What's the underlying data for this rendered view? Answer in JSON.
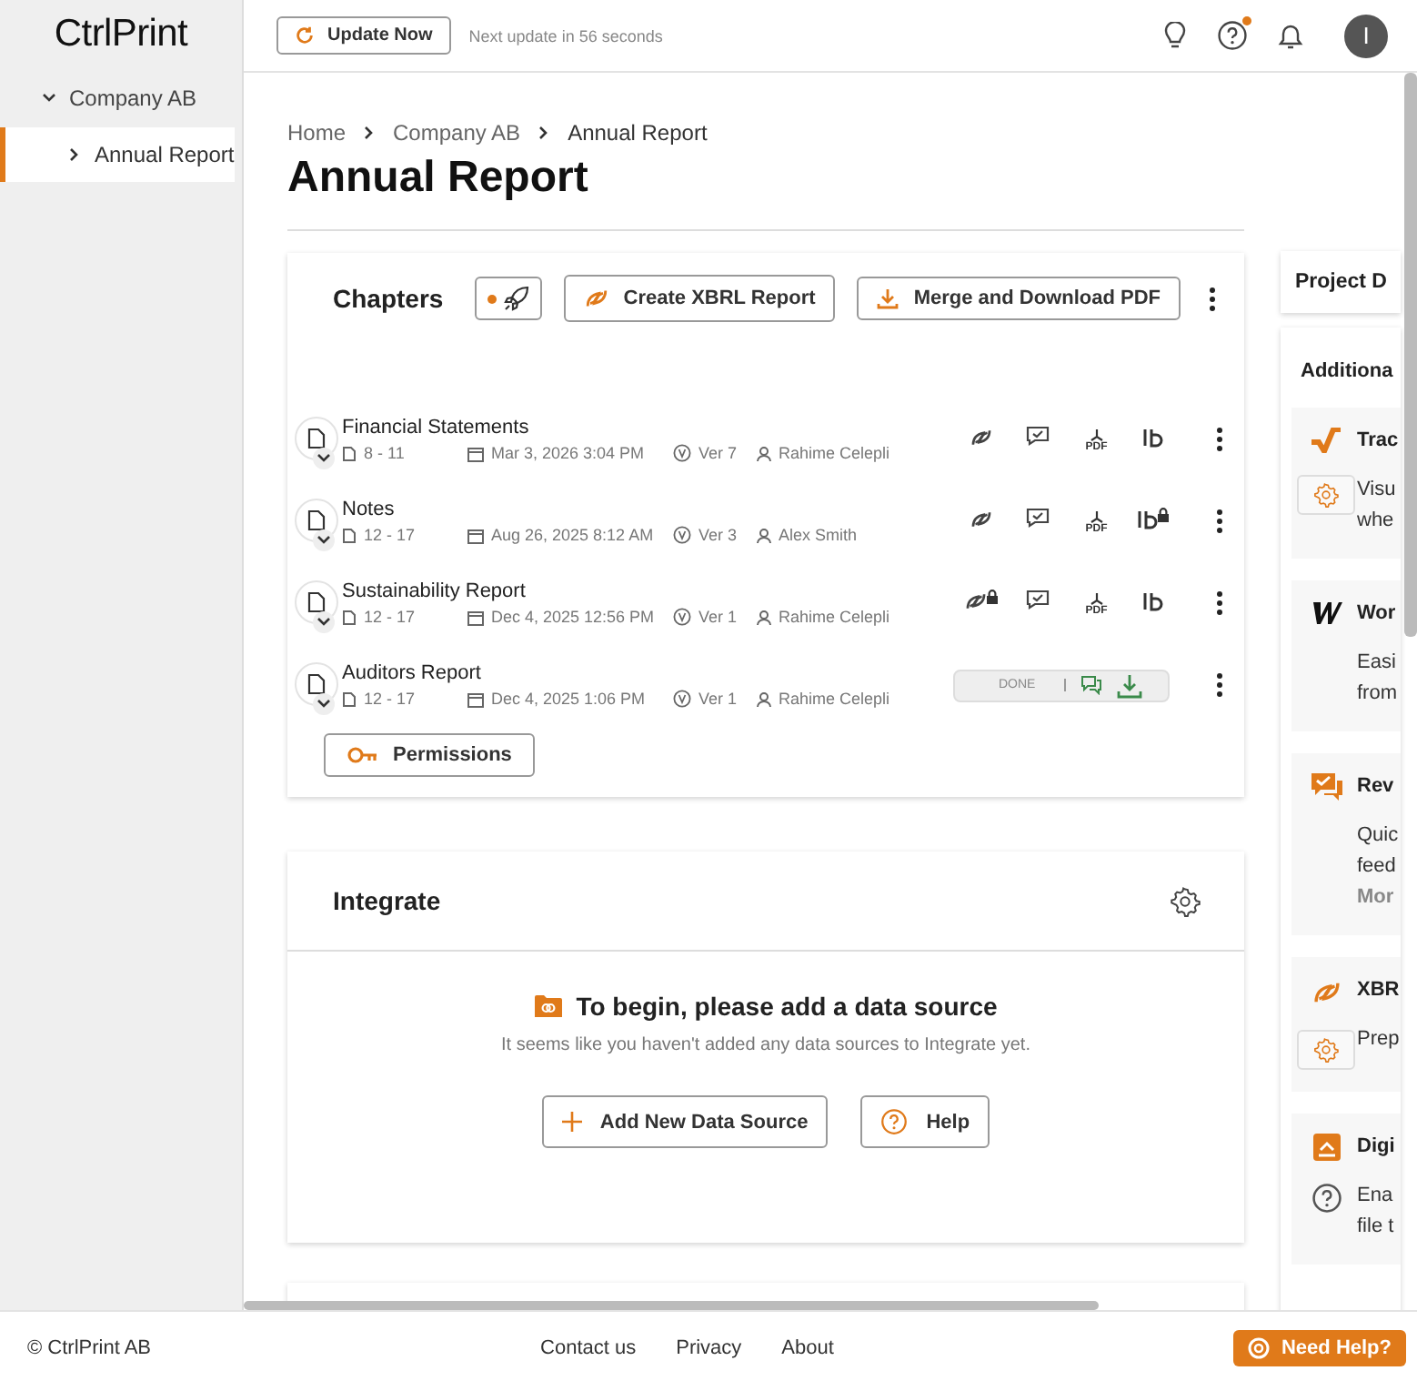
{
  "header": {
    "logo": "CtrlPrint",
    "update_button": "Update Now",
    "update_note": "Next update in 56 seconds",
    "icons": [
      {
        "kind": "bulb",
        "badge": false
      },
      {
        "kind": "help",
        "badge": true
      },
      {
        "kind": "bell",
        "badge": false
      }
    ],
    "avatar": "I"
  },
  "sidebar": {
    "items": [
      {
        "label": "Company AB",
        "expanded": true,
        "selected": false,
        "children": [
          {
            "label": "Annual Report",
            "expanded": false,
            "selected": true
          }
        ]
      }
    ]
  },
  "breadcrumb": [
    "Home",
    "Company AB",
    "Annual Report"
  ],
  "title": "Annual Report",
  "chapters": {
    "title": "Chapters",
    "notice": true,
    "buttons": [
      "Create XBRL Report",
      "Merge and Download PDF"
    ],
    "rows": [
      {
        "name": "Financial Statements",
        "pages": "8 - 11",
        "date": "Mar 3, 2026 3:04 PM",
        "version": "Ver 7",
        "author": "Rahime Celepli",
        "kind": "actions",
        "pdf": "PDF",
        "xbrl_locked": false,
        "id_locked": false
      },
      {
        "name": "Notes",
        "pages": "12 - 17",
        "date": "Aug 26, 2025 8:12 AM",
        "version": "Ver 3",
        "author": "Alex Smith",
        "kind": "actions",
        "pdf": "PDF",
        "xbrl_locked": false,
        "id_locked": true
      },
      {
        "name": "Sustainability Report",
        "pages": "12 - 17",
        "date": "Dec 4, 2025 12:56 PM",
        "version": "Ver 1",
        "author": "Rahime Celepli",
        "kind": "actions",
        "pdf": "PDF",
        "xbrl_locked": true,
        "id_locked": false
      },
      {
        "name": "Auditors Report",
        "pages": "12 - 17",
        "date": "Dec 4, 2025 1:06 PM",
        "version": "Ver 1",
        "author": "Rahime Celepli",
        "kind": "done",
        "status": "DONE"
      }
    ],
    "permissions": "Permissions"
  },
  "integrate": {
    "title": "Integrate",
    "empty_title": "To begin, please add a data source",
    "empty_text": "It seems like you haven't added any data sources to Integrate yet.",
    "buttons": [
      "Add New Data Source",
      "Help"
    ]
  },
  "side_panel": {
    "tab": "Project D",
    "title": "Additiona",
    "tools": [
      {
        "kind": "check",
        "title": "Trac",
        "settings": true,
        "help": false,
        "lines": [
          "Visu",
          "whe"
        ]
      },
      {
        "kind": "w",
        "title": "Wor",
        "settings": false,
        "help": false,
        "lines": [
          "Easi",
          "from"
        ]
      },
      {
        "kind": "chat",
        "title": "Rev",
        "settings": false,
        "help": false,
        "lines": [
          "Quic",
          "feed"
        ],
        "more": "Mor"
      },
      {
        "kind": "xbrl",
        "title": "XBR",
        "settings": true,
        "help": false,
        "lines": [
          "Prep"
        ]
      },
      {
        "kind": "box",
        "title": "Digi",
        "settings": false,
        "help": true,
        "lines": [
          "Ena",
          "file t"
        ]
      }
    ]
  },
  "footer": {
    "copyright": "© CtrlPrint AB",
    "links": [
      "Contact us",
      "Privacy",
      "About"
    ],
    "help": "Need Help?"
  }
}
